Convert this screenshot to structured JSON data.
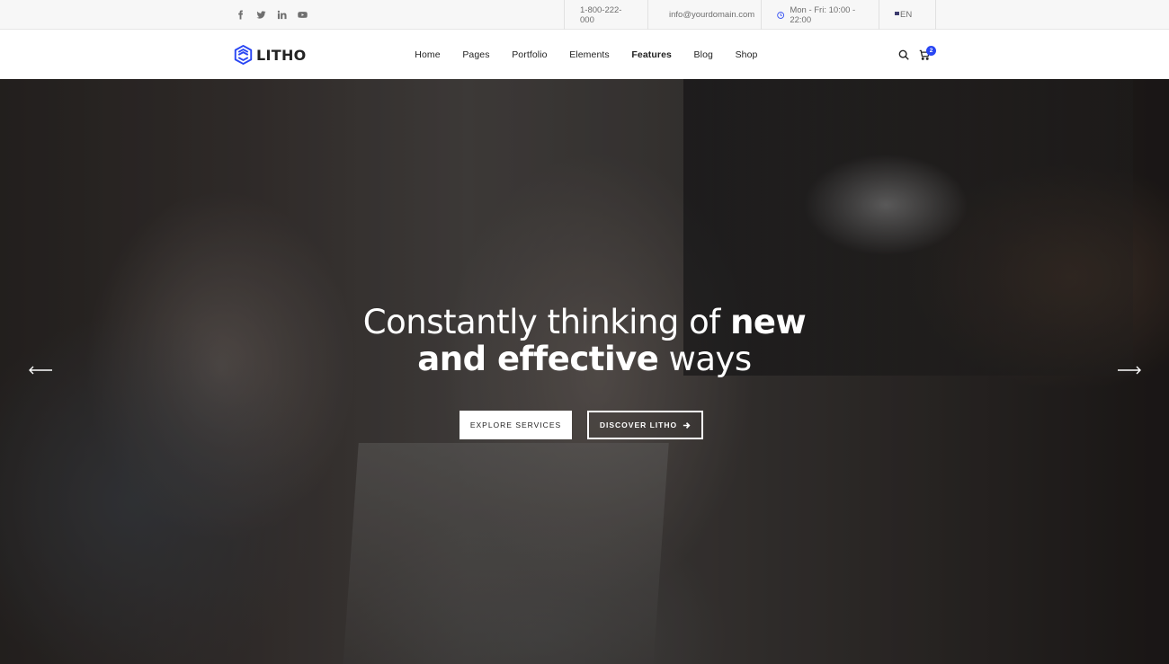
{
  "topbar": {
    "social": [
      "facebook-icon",
      "twitter-icon",
      "linkedin-icon",
      "youtube-icon"
    ],
    "phone": "1-800-222-000",
    "email": "info@yourdomain.com",
    "hours": "Mon - Fri: 10:00 - 22:00",
    "language": "EN"
  },
  "header": {
    "logo_text": "LITHO",
    "nav": [
      {
        "label": "Home"
      },
      {
        "label": "Pages"
      },
      {
        "label": "Portfolio"
      },
      {
        "label": "Elements"
      },
      {
        "label": "Features",
        "active": true
      },
      {
        "label": "Blog"
      },
      {
        "label": "Shop"
      }
    ],
    "cart_count": "2"
  },
  "hero": {
    "headline_thin_1": "Constantly thinking of ",
    "headline_bold_1": "new",
    "headline_bold_2": "and effective",
    "headline_thin_2": " ways",
    "explore_label": "EXPLORE SERVICES",
    "discover_label": "DISCOVER LITHO"
  },
  "colors": {
    "accent": "#2946f3",
    "text": "#232323",
    "topbar_bg": "#f7f7f7"
  }
}
